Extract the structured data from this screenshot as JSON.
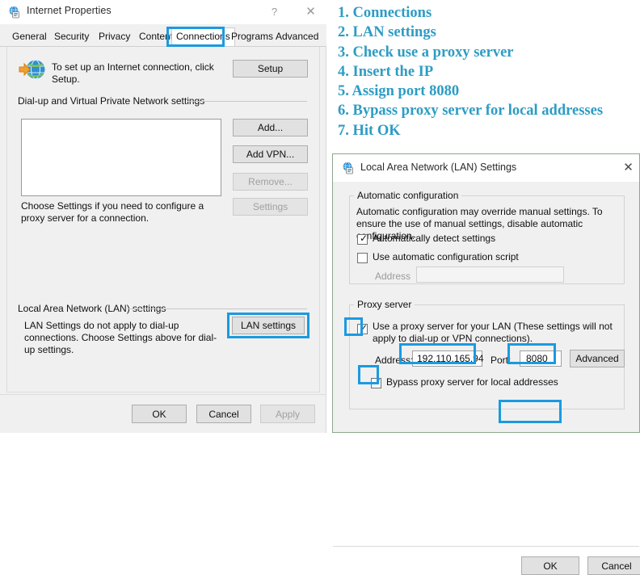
{
  "internet_properties": {
    "title": "Internet Properties",
    "title_icon": "internet-properties-icon",
    "help_button": "?",
    "close_button": "✕",
    "tabs": [
      {
        "label": "General",
        "selected": false
      },
      {
        "label": "Security",
        "selected": false
      },
      {
        "label": "Privacy",
        "selected": false
      },
      {
        "label": "Content",
        "selected": false
      },
      {
        "label": "Connections",
        "selected": true
      },
      {
        "label": "Programs",
        "selected": false
      },
      {
        "label": "Advanced",
        "selected": false
      }
    ],
    "setup_text": "To set up an Internet connection, click Setup.",
    "setup_button": "Setup",
    "dialup_group_label": "Dial-up and Virtual Private Network settings",
    "dialup_list_value": "",
    "add_button": "Add...",
    "add_vpn_button": "Add VPN...",
    "remove_button": "Remove...",
    "settings_button": "Settings",
    "choose_settings_text": "Choose Settings if you need to configure a proxy server for a connection.",
    "lan_group_label": "Local Area Network (LAN) settings",
    "lan_desc_text": "LAN Settings do not apply to dial-up connections. Choose Settings above for dial-up settings.",
    "lan_settings_button": "LAN settings",
    "ok_button": "OK",
    "cancel_button": "Cancel",
    "apply_button": "Apply"
  },
  "steps": [
    "1. Connections",
    "2. LAN settings",
    "3. Check use a proxy server",
    "4. Insert the IP",
    "5. Assign port 8080",
    "6. Bypass proxy server for local addresses",
    "7. Hit OK"
  ],
  "lan_settings": {
    "title": "Local Area Network (LAN) Settings",
    "title_icon": "lan-settings-icon",
    "close_button": "✕",
    "auto_config": {
      "group_label": "Automatic configuration",
      "description": "Automatic configuration may override manual settings.  To ensure the use of manual settings, disable automatic configuration.",
      "auto_detect_label": "Automatically detect settings",
      "auto_detect_checked": true,
      "use_script_label": "Use automatic configuration script",
      "use_script_checked": false,
      "address_label": "Address",
      "address_value": "",
      "address_enabled": false
    },
    "proxy": {
      "group_label": "Proxy server",
      "use_proxy_label": "Use a proxy server for your LAN (These settings will not apply to dial-up or VPN connections).",
      "use_proxy_checked": true,
      "address_label": "Address:",
      "address_value": "192.110.165.94",
      "port_label": "Port:",
      "port_value": "8080",
      "advanced_button": "Advanced",
      "bypass_label": "Bypass proxy server for local addresses",
      "bypass_checked": true
    },
    "ok_button": "OK",
    "cancel_button": "Cancel"
  },
  "colors": {
    "annotation_highlight": "#1b9ae0",
    "step_text": "#2d9cc4",
    "window_background": "#f0f0f0",
    "button_face": "#e1e1e1"
  }
}
